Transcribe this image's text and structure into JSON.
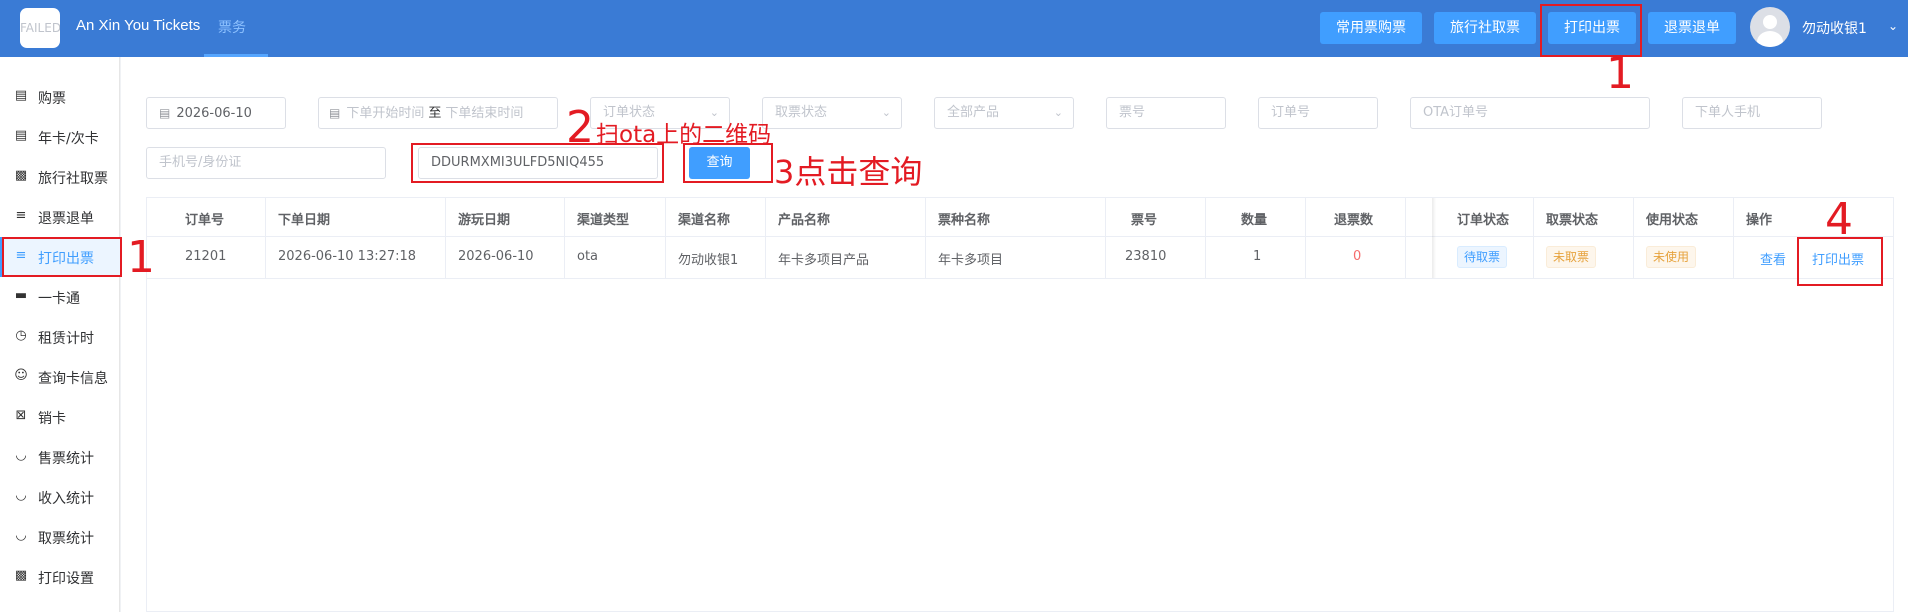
{
  "header": {
    "logo_text": "FAILED",
    "app_title": "An Xin You Tickets",
    "nav_tab": "票务",
    "buttons": [
      "常用票购票",
      "旅行社取票",
      "打印出票",
      "退票退单"
    ],
    "username": "勿动收银1"
  },
  "sidebar": {
    "items": [
      {
        "label": "购票",
        "icon": "document-icon"
      },
      {
        "label": "年卡/次卡",
        "icon": "document-icon"
      },
      {
        "label": "旅行社取票",
        "icon": "bookmark-icon"
      },
      {
        "label": "退票退单",
        "icon": "sliders-icon"
      },
      {
        "label": "打印出票",
        "icon": "sliders-icon"
      },
      {
        "label": "一卡通",
        "icon": "card-icon"
      },
      {
        "label": "租赁计时",
        "icon": "timer-icon"
      },
      {
        "label": "查询卡信息",
        "icon": "user-icon"
      },
      {
        "label": "销卡",
        "icon": "cancel-doc-icon"
      },
      {
        "label": "售票统计",
        "icon": "chart-icon"
      },
      {
        "label": "收入统计",
        "icon": "chart-icon"
      },
      {
        "label": "取票统计",
        "icon": "chart-icon"
      },
      {
        "label": "打印设置",
        "icon": "printer-icon"
      }
    ],
    "active_index": 4
  },
  "filters": {
    "date": "2026-06-10",
    "start_time_placeholder": "下单开始时间",
    "range_separator": "至",
    "end_time_placeholder": "下单结束时间",
    "order_status_placeholder": "订单状态",
    "ticket_status_placeholder": "取票状态",
    "product_placeholder": "全部产品",
    "ticket_no_placeholder": "票号",
    "order_no_placeholder": "订单号",
    "ota_order_placeholder": "OTA订单号",
    "phone_placeholder": "下单人手机",
    "id_placeholder": "手机号/身份证",
    "qr_value": "DDURMXMI3ULFD5NIQ455",
    "query_button": "查询"
  },
  "table": {
    "headers": [
      "订单号",
      "下单日期",
      "游玩日期",
      "渠道类型",
      "渠道名称",
      "产品名称",
      "票种名称",
      "票号",
      "数量",
      "退票数",
      "订单状态",
      "取票状态",
      "使用状态",
      "操作"
    ],
    "rows": [
      {
        "order_no": "21201",
        "order_date": "2026-06-10 13:27:18",
        "play_date": "2026-06-10",
        "channel_type": "ota",
        "channel_name": "勿动收银1",
        "product_name": "年卡多项目产品",
        "ticket_type": "年卡多项目",
        "ticket_no": "23810",
        "quantity": "1",
        "refund_count": "0",
        "order_status": "待取票",
        "pickup_status": "未取票",
        "use_status": "未使用",
        "action_view": "查看",
        "action_print": "打印出票"
      }
    ]
  },
  "annotations": {
    "step1_top": "1",
    "step1_side": "1",
    "step2_num": "2",
    "step2_text": "扫ota上的二维码",
    "step3_text": "3点击查询",
    "step4_num": "4"
  },
  "colors": {
    "header_bg": "#3a7bd5",
    "primary": "#409eff",
    "annotation": "#e31b23",
    "danger": "#f56c6c",
    "warning": "#e6a23c"
  }
}
